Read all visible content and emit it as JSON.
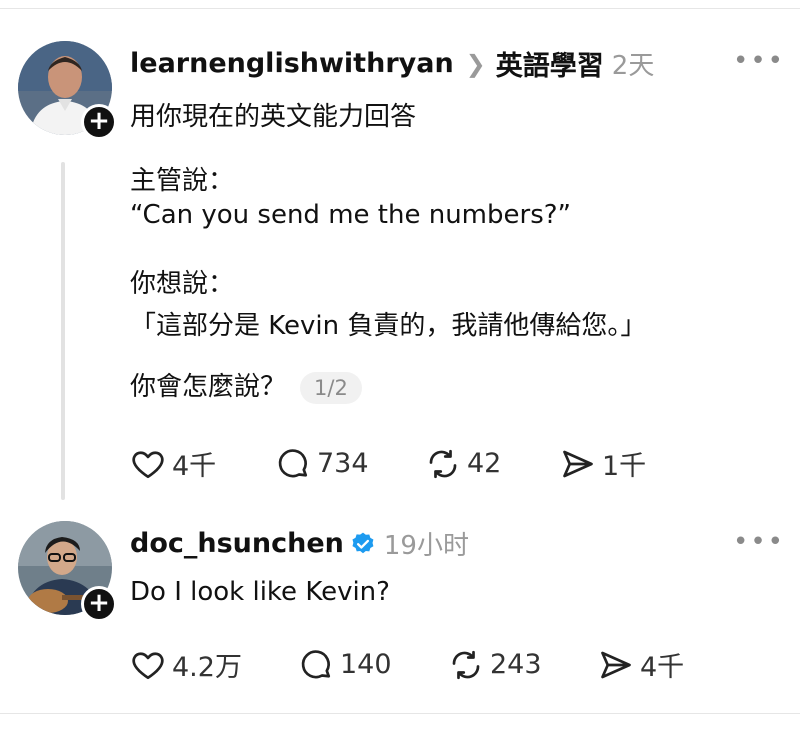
{
  "post": {
    "username": "learnenglishwithryan",
    "topic": "英語學習",
    "time": "2天",
    "more_label": "•••",
    "intro": "用你現在的英文能力回答",
    "boss_label": "主管說：",
    "boss_quote": "“Can you send me the numbers?”",
    "want_label": "你想說：",
    "want_quote": "「這部分是 Kevin 負責的，我請他傳給您。」",
    "question": "你會怎麼說？",
    "page_indicator": "1/2",
    "likes": "4千",
    "comments": "734",
    "reposts": "42",
    "shares": "1千"
  },
  "reply": {
    "username": "doc_hsunchen",
    "time": "19小时",
    "more_label": "•••",
    "text": "Do I look like Kevin?",
    "likes": "4.2万",
    "comments": "140",
    "reposts": "243",
    "shares": "4千"
  },
  "colors": {
    "verified_blue": "#1d9bf0",
    "muted_gray": "#9a9a9a"
  },
  "icons": [
    "plus-icon",
    "chevron-right-icon",
    "more-icon",
    "heart-icon",
    "comment-icon",
    "repost-icon",
    "share-icon",
    "verified-badge-icon"
  ]
}
